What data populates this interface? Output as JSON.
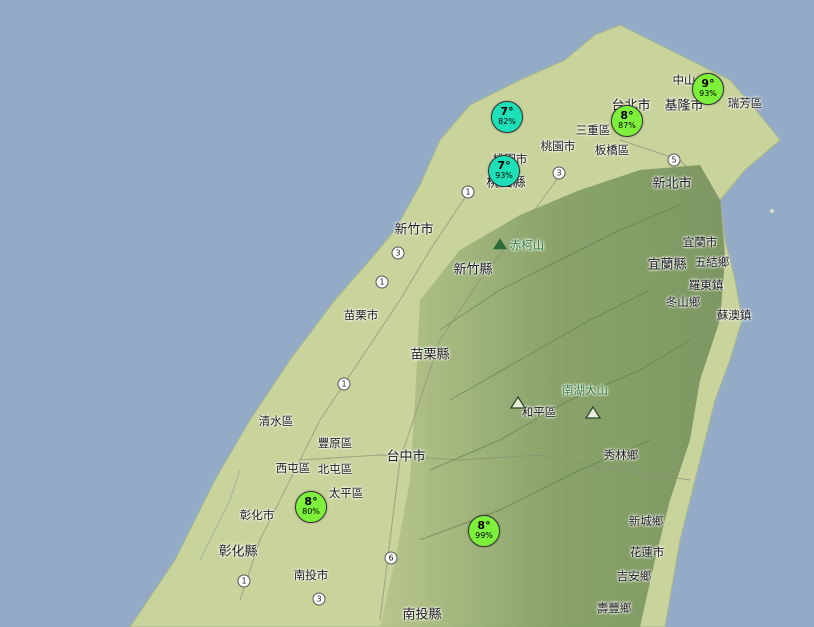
{
  "colors": {
    "sea": "#94abc7",
    "land": "#c8d29a",
    "mountain": "#7e9a63",
    "ridge": "#5f7c4c",
    "marker_teal": "#1de0b8",
    "marker_green": "#7cf03a"
  },
  "places": [
    {
      "key": "taipei",
      "label": "台北市"
    },
    {
      "key": "keelung",
      "label": "基隆市"
    },
    {
      "key": "zhongshan",
      "label": "中山"
    },
    {
      "key": "ruifang",
      "label": "瑞芳區"
    },
    {
      "key": "sanchong",
      "label": "三重區"
    },
    {
      "key": "banqiao",
      "label": "板橋區"
    },
    {
      "key": "taoyuan",
      "label": "桃園市"
    },
    {
      "key": "xinbei",
      "label": "新北市"
    },
    {
      "key": "yangmei",
      "label": "桃園縣"
    },
    {
      "key": "taoyuan_city",
      "label": "桃園市"
    },
    {
      "key": "hsinchu_city",
      "label": "新竹市"
    },
    {
      "key": "hsinchu_county",
      "label": "新竹縣"
    },
    {
      "key": "yilan_city",
      "label": "宜蘭市"
    },
    {
      "key": "wujie",
      "label": "五結鄉"
    },
    {
      "key": "yilan_county",
      "label": "宜蘭縣"
    },
    {
      "key": "luodong",
      "label": "羅東鎮"
    },
    {
      "key": "dongshan",
      "label": "冬山鄉"
    },
    {
      "key": "suao",
      "label": "蘇澳鎮"
    },
    {
      "key": "chikeshan",
      "label": "赤柯山"
    },
    {
      "key": "miaoli_city",
      "label": "苗栗市"
    },
    {
      "key": "miaoli_county",
      "label": "苗栗縣"
    },
    {
      "key": "nanhu",
      "label": "南湖大山"
    },
    {
      "key": "heping",
      "label": "和平區"
    },
    {
      "key": "qingshui",
      "label": "清水區"
    },
    {
      "key": "fengyuan",
      "label": "豐原區"
    },
    {
      "key": "xitun",
      "label": "西屯區"
    },
    {
      "key": "beitun",
      "label": "北屯區"
    },
    {
      "key": "taiping",
      "label": "太平區"
    },
    {
      "key": "taichung",
      "label": "台中市"
    },
    {
      "key": "xiulin",
      "label": "秀林鄉"
    },
    {
      "key": "changhua_city",
      "label": "彰化市"
    },
    {
      "key": "changhua_county",
      "label": "彰化縣"
    },
    {
      "key": "xincheng",
      "label": "新城鄉"
    },
    {
      "key": "hualien",
      "label": "花蓮市"
    },
    {
      "key": "jian",
      "label": "吉安鄉"
    },
    {
      "key": "nantou_city",
      "label": "南投市"
    },
    {
      "key": "nantou_county",
      "label": "南投縣"
    },
    {
      "key": "shoufeng",
      "label": "壽豐鄉"
    }
  ],
  "road_shields": [
    "1",
    "3",
    "5",
    "3",
    "1",
    "1",
    "6",
    "1",
    "3"
  ],
  "weather_markers": [
    {
      "temp": "7°",
      "humidity": "82%",
      "color": "teal"
    },
    {
      "temp": "7°",
      "humidity": "93%",
      "color": "teal"
    },
    {
      "temp": "8°",
      "humidity": "87%",
      "color": "green"
    },
    {
      "temp": "9°",
      "humidity": "93%",
      "color": "green"
    },
    {
      "temp": "8°",
      "humidity": "80%",
      "color": "green"
    },
    {
      "temp": "8°",
      "humidity": "99%",
      "color": "green"
    }
  ]
}
